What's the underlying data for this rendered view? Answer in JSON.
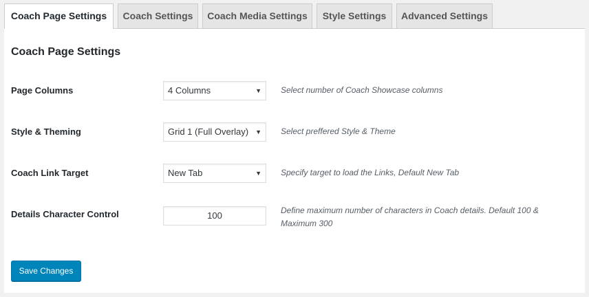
{
  "tabs": [
    {
      "label": "Coach Page Settings",
      "active": true
    },
    {
      "label": "Coach Settings",
      "active": false
    },
    {
      "label": "Coach Media Settings",
      "active": false
    },
    {
      "label": "Style Settings",
      "active": false
    },
    {
      "label": "Advanced Settings",
      "active": false
    }
  ],
  "panel": {
    "title": "Coach Page Settings"
  },
  "fields": {
    "page_columns": {
      "label": "Page Columns",
      "value": "4 Columns",
      "description": "Select number of Coach Showcase columns"
    },
    "style_theming": {
      "label": "Style & Theming",
      "value": "Grid 1 (Full Overlay)",
      "description": "Select preffered Style & Theme"
    },
    "link_target": {
      "label": "Coach Link Target",
      "value": "New Tab",
      "description": "Specify target to load the Links, Default New Tab"
    },
    "char_control": {
      "label": "Details Character Control",
      "value": "100",
      "description": "Define maximum number of characters in Coach details. Default 100 & Maximum 300"
    }
  },
  "icons": {
    "caret": "▼"
  },
  "colors": {
    "primary_button": "#0085ba",
    "active_tab": "#ffffff",
    "inactive_tab": "#e5e5e5",
    "background": "#f1f1f1"
  },
  "actions": {
    "save_label": "Save Changes"
  }
}
